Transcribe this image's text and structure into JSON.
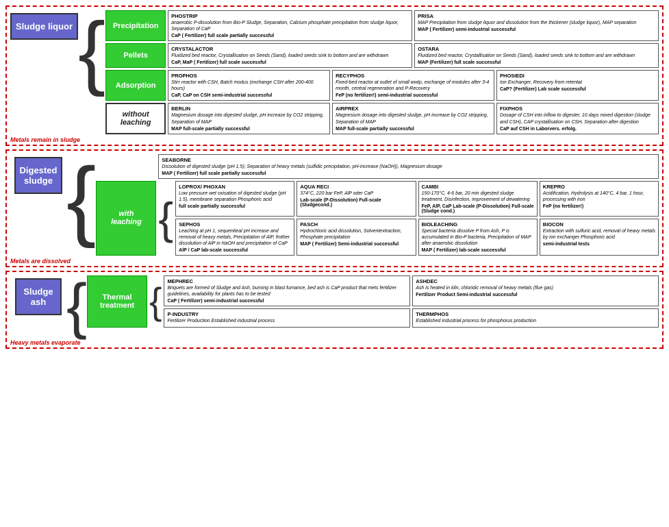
{
  "sections": {
    "sludge_liquor": {
      "title": "Sludge\nliquor",
      "sub_label": "Metals remain\nin sludge",
      "categories": {
        "precipitation": "Precipitation",
        "pellets": "Pellets",
        "adsorption": "Adsorption",
        "without_leaching": "without\nleaching"
      }
    },
    "digested_sludge": {
      "title": "Digested\nsludge",
      "sub_label": "Metals are\ndissolved"
    },
    "sludge_ash": {
      "title": "Sludge\nash",
      "sub_label": "Heavy metals\nevaporate",
      "categories": {
        "thermal": "Thermal\ntreatment"
      }
    }
  },
  "cards": {
    "phostrip": {
      "title": "PHOSTRIP",
      "desc": "anaerobic P-dissolution from Bio-P Sludge, Separation, Calcium phosphate precipitation from sludge liquor, Separation of CaP",
      "footer": "CaP ( Fertilizer)     full scale partially successful"
    },
    "prisa": {
      "title": "PRISA",
      "desc": "MAP Precipitation from sludge liquor and dissolution from the thickener (sludge liquor), MAP separation",
      "footer": "MAP ( Fertilizer)       semi-industrial successful"
    },
    "crystalactor": {
      "title": "CRYSTALACTOR",
      "desc": "Fluidized bed reactor, Crystallisation on Seeds (Sand), loaded seeds sink to bottom and are withdrawn",
      "footer": "CaP, MaP ( Fertilizer)     full scale successful"
    },
    "ostara": {
      "title": "OSTARA",
      "desc": "Fluidized bed reactor, Crystallisation on Seeds (Sand), loaded seeds sink to bottom and are withdrawn",
      "footer": "MAP (Fertilizer)       full scale successful"
    },
    "prophos": {
      "title": "PROPHOS",
      "desc": "Stirr reactor with CSH, Batch modus (exchange CSH after 200-400 hours)",
      "footer": "CaP, CaP on CSH   semi-industrial successful"
    },
    "recyphos": {
      "title": "RECYPHOS",
      "desc": "Fixed-bed reactor at outlet of small wwtp, exchange of modules after 3-4 month, central regeneration and P-Recovery",
      "footer": "FeP (no fertilizer!)     semi-industrial successful"
    },
    "phosiedi": {
      "title": "PHOSIEDI",
      "desc": "Ion Exchanger, Recovery from retentat",
      "footer": "CaP? (Fertilizer)       Lab scale successful"
    },
    "berlin": {
      "title": "BERLIN",
      "desc": "Magnesium dosage into digested sludge, pH increase by CO2 stripping, Separation of MAP",
      "footer": "MAP         full-scale partially successful"
    },
    "airprex": {
      "title": "AIRPREX",
      "desc": "Magnesium dosage into digested sludge, pH increase by CO2 stripping, Separation of MAP",
      "footer": "MAP         full-scale partially successful"
    },
    "fixphos": {
      "title": "FIXPHOS",
      "desc": "Dosage of CSH into inflow to digester, 10 days mixed digestion (sludge and CSH), CAP crystallisation on CSH, Separation after digestion",
      "footer": "CaP auf CSH    in Laborvers. erfolg."
    },
    "seaborne": {
      "title": "SEABORNE",
      "desc": "Dissolution of digested sludge (pH 1.5); Separation of heavy metals (sulfidic precipitation, pH-increase (NaOH)), Magnesium dosage",
      "footer": "MAP ( Fertilizer)       full scale partially successful"
    },
    "loprox": {
      "title": "LOPROX/ PHOXAN",
      "desc": "Low pressure wet oxisation of digested sludge (pH 1.5), membrane separation Phosphoric acid",
      "footer": "full scale partially successful"
    },
    "aqua_reci": {
      "title": "AQUA RECI",
      "desc": "374°C, 220 bar FeP, AlP oder CaP",
      "footer": "Lab-scale (P-Dissolution)\nFull-scale (Sludgecond.)"
    },
    "cambi": {
      "title": "CAMBI",
      "desc": "150-170°C, 4-6 bar, 20 min digested sludge treatment, Disinfection, improvement of dewatering",
      "footer": "FeP, AlP, CaP     Lab-scale (P-Dissolution)\n                       Full-scale (Sludge cond.)"
    },
    "krepro": {
      "title": "KREPRO",
      "desc": "Acidification, Hydrolysis at 140°C, 4 bar, 1 hour, processing with iron",
      "footer": "FeP (no fertilizer!)"
    },
    "sephos": {
      "title": "SEPHOS",
      "desc": "Leaching at pH 1, sequentieal pH increase and removal of heavy metals, Precipitation of AlP, frother dissolution of AlP in NaOH and precipitation of CaP",
      "footer": "AlP / CaP       lab-scale successful"
    },
    "pasch": {
      "title": "PASCH",
      "desc": "Hydrochloric acid dissolution, Solventextraction, Phosphate precipitation",
      "footer": "MAP ( Fertilizer)\nSemi-industrial successful"
    },
    "bioleaching": {
      "title": "BIOLEACHING",
      "desc": "Special bacteria dissolve P from Ash, P is accumulated in Bio-P bacteria, Precipitation of MAP after anaerobic dissolution",
      "footer": "MAP ( Fertilizer) lab-scale successful"
    },
    "biocon": {
      "title": "BIOCON",
      "desc": "Extraction with sulfuric acid, removal of heavy metals by ion exchanger Phosphoric acid",
      "footer": "semi-industrial tests"
    },
    "mephrec": {
      "title": "MEPHREC",
      "desc": "Briquets are formed of Sludge and Ash, burning in blast furnance, bed ash is CaP product that mets fertilizer guidelines, availability for plants has to be tested",
      "footer": "CaP ( Fertilizer)       semi-industrial successful"
    },
    "ashdec": {
      "title": "ASHDEC",
      "desc": "Ash is heated in kiln, chloridic removal of heavy metals (flue gas)",
      "footer": "Fertilizer Product     Semi-industrial successful"
    },
    "p_industry": {
      "title": "P-INDUSTRY",
      "desc": "Fertilizer Production Established industrial process",
      "footer": ""
    },
    "thermphos": {
      "title": "THERMPHOS",
      "desc": "Established industrial process for phosphorus production",
      "footer": ""
    }
  }
}
